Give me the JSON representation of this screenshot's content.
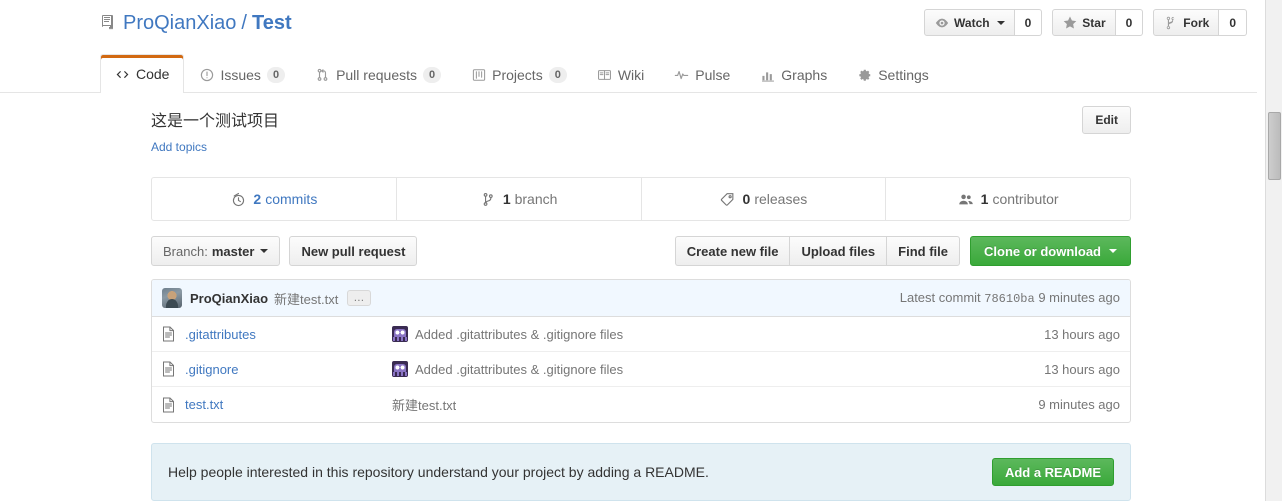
{
  "repo": {
    "book_icon": "repo-book-icon",
    "owner": "ProQianXiao",
    "separator": "/",
    "name": "Test",
    "description": "这是一个测试项目",
    "add_topics_label": "Add topics",
    "edit_label": "Edit"
  },
  "social": [
    {
      "icon": "eye-icon",
      "label": "Watch",
      "count": "0",
      "has_caret": true
    },
    {
      "icon": "star-icon",
      "label": "Star",
      "count": "0",
      "has_caret": false
    },
    {
      "icon": "fork-icon",
      "label": "Fork",
      "count": "0",
      "has_caret": false
    }
  ],
  "nav_tabs": [
    {
      "icon": "code-icon",
      "label": "Code",
      "count": null,
      "active": true
    },
    {
      "icon": "issue-opened-icon",
      "label": "Issues",
      "count": "0",
      "active": false
    },
    {
      "icon": "git-pull-request-icon",
      "label": "Pull requests",
      "count": "0",
      "active": false
    },
    {
      "icon": "project-icon",
      "label": "Projects",
      "count": "0",
      "active": false
    },
    {
      "icon": "book-icon",
      "label": "Wiki",
      "count": null,
      "active": false
    },
    {
      "icon": "pulse-icon",
      "label": "Pulse",
      "count": null,
      "active": false
    },
    {
      "icon": "graph-icon",
      "label": "Graphs",
      "count": null,
      "active": false
    },
    {
      "icon": "gear-icon",
      "label": "Settings",
      "count": null,
      "active": false
    }
  ],
  "stats": [
    {
      "icon": "history-icon",
      "num": "2",
      "label": "commits",
      "link": true
    },
    {
      "icon": "git-branch-icon",
      "num": "1",
      "label": "branch",
      "link": false
    },
    {
      "icon": "tag-icon",
      "num": "0",
      "label": "releases",
      "link": false
    },
    {
      "icon": "people-icon",
      "num": "1",
      "label": "contributor",
      "link": false
    }
  ],
  "actions": {
    "branch_prefix": "Branch:",
    "branch_name": "master",
    "new_pull_request": "New pull request",
    "create_new_file": "Create new file",
    "upload_files": "Upload files",
    "find_file": "Find file",
    "clone_or_download": "Clone or download"
  },
  "latest_commit": {
    "avatar": "user-avatar",
    "author": "ProQianXiao",
    "message": "新建test.txt",
    "expand_label": "…",
    "meta_prefix": "Latest commit",
    "sha": "78610ba",
    "age": "9 minutes ago"
  },
  "files": [
    {
      "icon": "file-icon",
      "name": ".gitattributes",
      "commit_avatar": "committer-avatar",
      "commit_message": "Added .gitattributes & .gitignore files",
      "age": "13 hours ago"
    },
    {
      "icon": "file-icon",
      "name": ".gitignore",
      "commit_avatar": "committer-avatar",
      "commit_message": "Added .gitattributes & .gitignore files",
      "age": "13 hours ago"
    },
    {
      "icon": "file-icon",
      "name": "test.txt",
      "commit_avatar": null,
      "commit_message": "新建test.txt",
      "age": "9 minutes ago"
    }
  ],
  "readme_callout": {
    "text": "Help people interested in this repository understand your project by adding a README.",
    "button_label": "Add a README"
  },
  "colors": {
    "link": "#4078c0",
    "active_tab_accent": "#d26911",
    "green_button": "#3aa93a",
    "callout_bg": "#e6f1f6",
    "commit_bar_bg": "#f1f8ff"
  }
}
